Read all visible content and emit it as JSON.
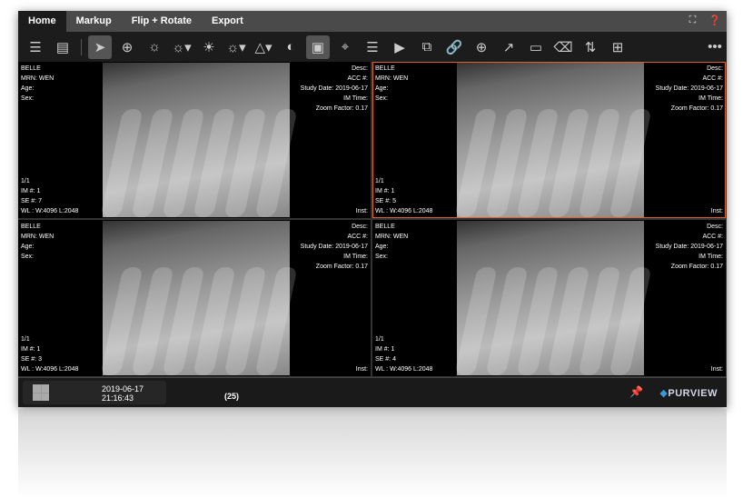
{
  "tabs": [
    "Home",
    "Markup",
    "Flip + Rotate",
    "Export"
  ],
  "tab_icons": [
    "fullscreen-icon",
    "help-icon"
  ],
  "toolbar": [
    "list-icon",
    "document-icon",
    "pointer-icon",
    "magnify-region-icon",
    "brightness-icon",
    "brightness-dropdown-icon",
    "auto-brightness-icon",
    "brightness-disabled-icon",
    "triangle-dropdown-icon",
    "invert-icon",
    "roi-icon",
    "crosshair-icon",
    "stack-icon",
    "play-icon",
    "series-icon",
    "link-icon",
    "zoom-icon",
    "arrow-icon",
    "ruler-icon",
    "eraser-icon",
    "swap-icon",
    "layout-icon",
    "more-icon"
  ],
  "viewports": [
    {
      "name": "BELLE",
      "mrn": "MRN: WEN",
      "age": "Age:",
      "sex": "Sex:",
      "desc": "Desc:",
      "acc": "ACC #:",
      "date": "Study Date: 2019-06-17",
      "imtime": "IM Time:",
      "zoom": "Zoom Factor: 0.17",
      "frame": "1/1",
      "im": "IM #: 1",
      "se": "SE #: 7",
      "wl": "WL : W:4096 L:2048",
      "inst": "Inst:"
    },
    {
      "name": "BELLE",
      "mrn": "MRN: WEN",
      "age": "Age:",
      "sex": "Sex:",
      "desc": "Desc:",
      "acc": "ACC #:",
      "date": "Study Date: 2019-06-17",
      "imtime": "IM Time:",
      "zoom": "Zoom Factor: 0.17",
      "frame": "1/1",
      "im": "IM #: 1",
      "se": "SE #: 5",
      "wl": "WL : W:4096 L:2048",
      "inst": "Inst:"
    },
    {
      "name": "BELLE",
      "mrn": "MRN: WEN",
      "age": "Age:",
      "sex": "Sex:",
      "desc": "Desc:",
      "acc": "ACC #:",
      "date": "Study Date: 2019-06-17",
      "imtime": "IM Time:",
      "zoom": "Zoom Factor: 0.17",
      "frame": "1/1",
      "im": "IM #: 1",
      "se": "SE #: 3",
      "wl": "WL : W:4096 L:2048",
      "inst": "Inst:"
    },
    {
      "name": "BELLE",
      "mrn": "MRN: WEN",
      "age": "Age:",
      "sex": "Sex:",
      "desc": "Desc:",
      "acc": "ACC #:",
      "date": "Study Date: 2019-06-17",
      "imtime": "IM Time:",
      "zoom": "Zoom Factor: 0.17",
      "frame": "1/1",
      "im": "IM #: 1",
      "se": "SE #: 4",
      "wl": "WL : W:4096 L:2048",
      "inst": "Inst:"
    }
  ],
  "footer": {
    "timestamp": "2019-06-17 21:16:43",
    "count": "(25)",
    "brand": "PURVIEW"
  },
  "colors": {
    "active_border": "#e0622a",
    "brand": "#3a9ad9"
  }
}
